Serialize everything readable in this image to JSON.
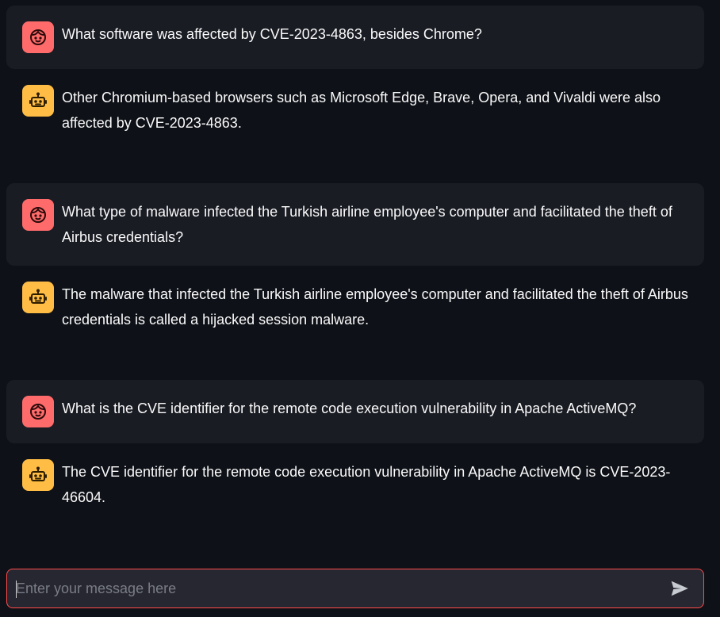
{
  "messages": [
    {
      "role": "user",
      "avatar_icon": "user-face-icon",
      "text": "What software was affected by CVE-2023-4863, besides Chrome?"
    },
    {
      "role": "assistant",
      "avatar_icon": "robot-icon",
      "text": "Other Chromium-based browsers such as Microsoft Edge, Brave, Opera, and Vivaldi were also affected by CVE-2023-4863."
    },
    {
      "role": "user",
      "avatar_icon": "user-face-icon",
      "text": "What type of malware infected the Turkish airline employee's computer and facilitated the theft of Airbus credentials?"
    },
    {
      "role": "assistant",
      "avatar_icon": "robot-icon",
      "text": "The malware that infected the Turkish airline employee's computer and facilitated the theft of Airbus credentials is called a hijacked session malware."
    },
    {
      "role": "user",
      "avatar_icon": "user-face-icon",
      "text": "What is the CVE identifier for the remote code execution vulnerability in Apache ActiveMQ?"
    },
    {
      "role": "assistant",
      "avatar_icon": "robot-icon",
      "text": "The CVE identifier for the remote code execution vulnerability in Apache ActiveMQ is CVE-2023-46604."
    }
  ],
  "chat_input": {
    "value": "",
    "placeholder": "Enter your message here",
    "send_icon": "send-icon"
  },
  "colors": {
    "background": "#0e1117",
    "user_bubble": "#1a1c24",
    "user_avatar": "#ff6b6b",
    "assistant_avatar": "#ffbd45",
    "input_border": "#ff4b4b",
    "input_background": "#262730"
  }
}
